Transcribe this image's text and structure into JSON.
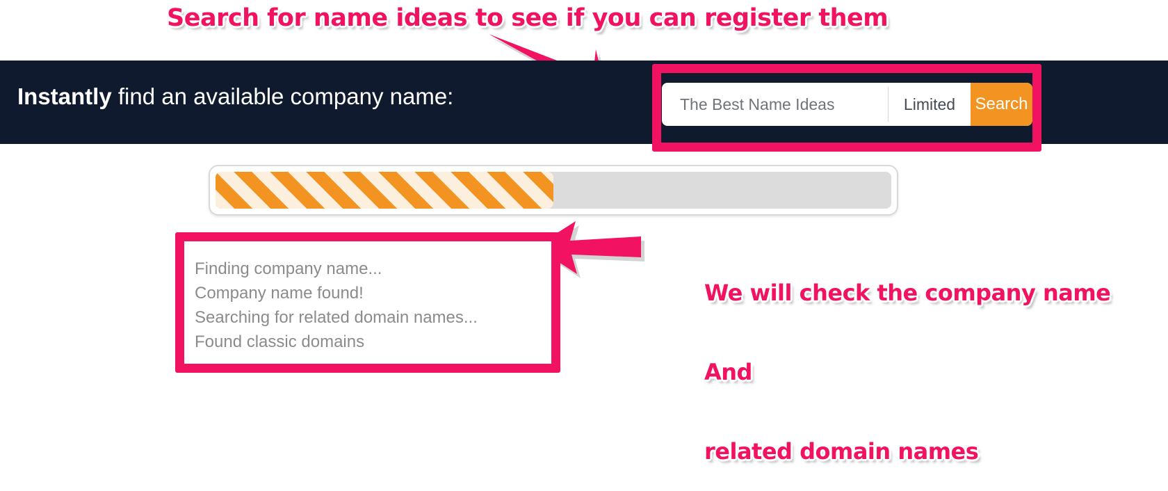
{
  "annotations": {
    "top": "Search for name ideas to see if you can register them",
    "right_lines": [
      "We will check the company name",
      "And",
      "related domain names"
    ],
    "color": "#F21262",
    "arrow_to_search": "arrow-down-right-icon",
    "arrow_to_status": "arrow-left-icon"
  },
  "header": {
    "title_strong": "Instantly",
    "title_rest": " find an available company name:",
    "background": "#101A2E"
  },
  "search": {
    "value": "The Best Name Ideas",
    "placeholder": "The Best Name Ideas",
    "suffix_selected": "Limited",
    "button_label": "Search",
    "button_color": "#F39422"
  },
  "progress": {
    "percent": 50,
    "fill_color": "#F39422",
    "track_color": "#dcdcdc"
  },
  "status": {
    "lines": [
      "Finding company name...",
      "Company name found!",
      "Searching for related domain names...",
      "Found classic domains"
    ]
  }
}
